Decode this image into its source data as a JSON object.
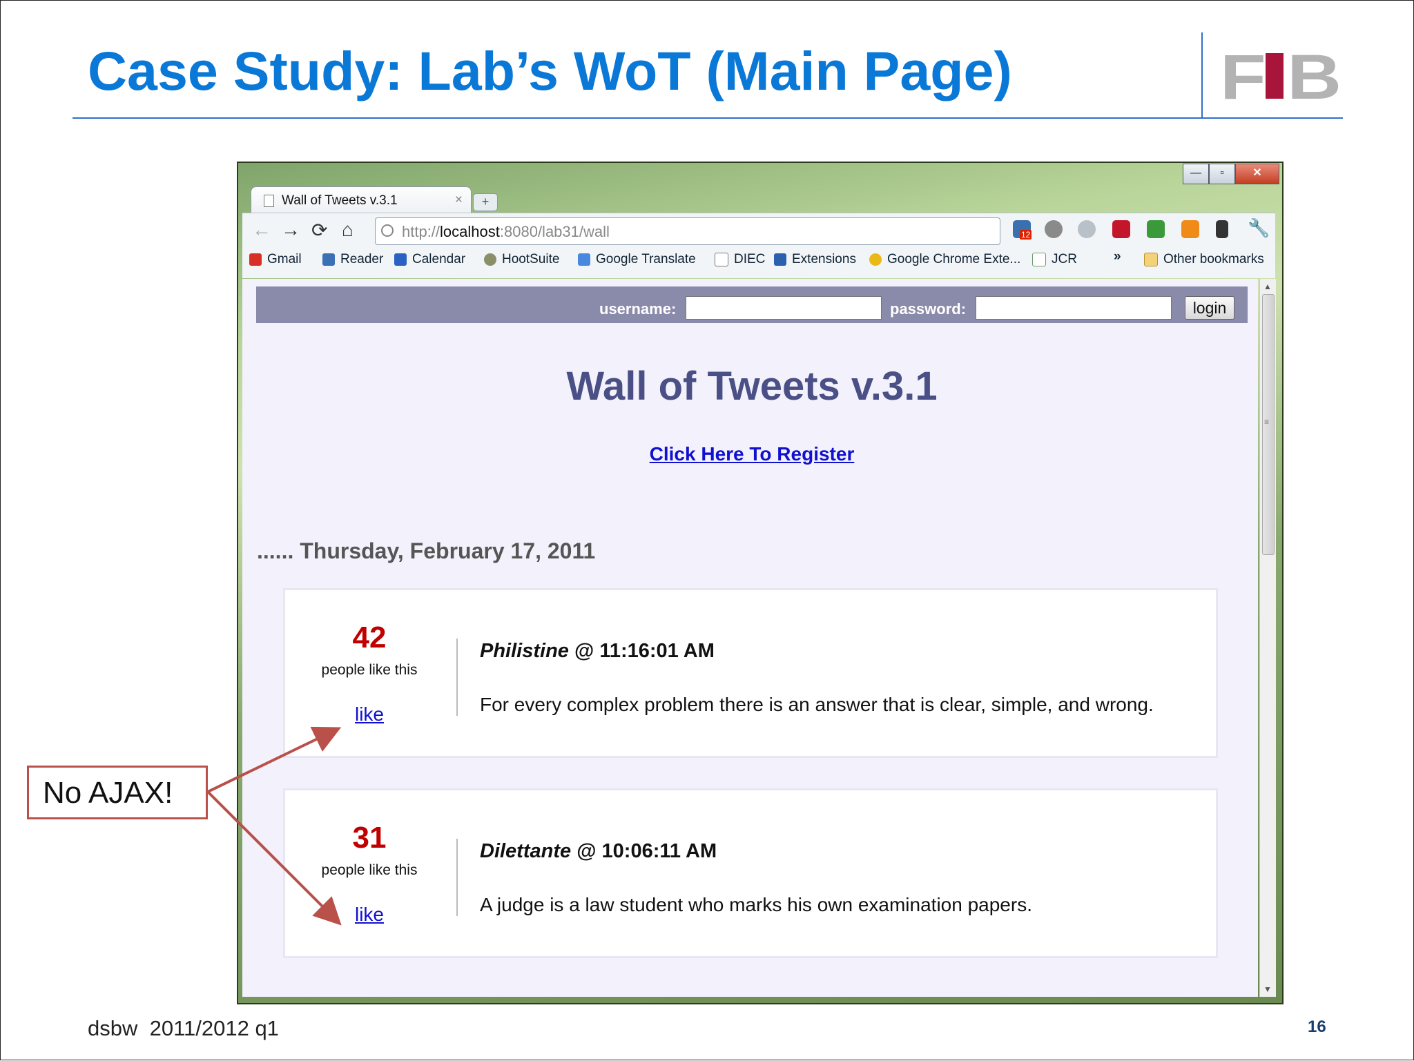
{
  "slide": {
    "title": "Case Study: Lab’s WoT (Main Page)",
    "logo_text": "FIB",
    "footer_left": "dsbw  2011/2012 q1",
    "page_number": "16",
    "callout": "No AJAX!",
    "colors": {
      "title": "#0a78d6",
      "callout_border": "#b9504a",
      "logo_red": "#a8143a"
    }
  },
  "browser": {
    "tab_title": "Wall of Tweets v.3.1",
    "tab_close": "×",
    "new_tab": "+",
    "url_prefix": "http://",
    "url_host": "localhost",
    "url_rest": ":8080/lab31/wall",
    "extension_badge": "12",
    "bookmarks": [
      "Gmail",
      "Reader",
      "Calendar",
      "HootSuite",
      "Google Translate",
      "DIEC",
      "Extensions",
      "Google Chrome Exte...",
      "JCR"
    ],
    "bookmarks_overflow": "»",
    "other_bookmarks": "Other bookmarks",
    "icons": [
      "back-arrow-icon",
      "forward-arrow-icon",
      "reload-icon",
      "home-icon",
      "globe-icon",
      "wrench-icon",
      "folder-icon"
    ]
  },
  "page": {
    "username_label": "username:",
    "password_label": "password:",
    "login_button": "login",
    "heading": "Wall of Tweets v.3.1",
    "register_link": "Click Here To Register",
    "date_heading": "...... Thursday, February 17, 2011",
    "tweets": [
      {
        "likes": "42",
        "people_label": "people like this",
        "like_link": "like",
        "author": "Philistine",
        "at": " @ ",
        "time": "11:16:01 AM",
        "text": "For every complex problem there is an answer that is clear, simple, and wrong."
      },
      {
        "likes": "31",
        "people_label": "people like this",
        "like_link": "like",
        "author": "Dilettante",
        "at": " @ ",
        "time": "10:06:11 AM",
        "text": "A judge is a law student who marks his own examination papers."
      }
    ]
  }
}
